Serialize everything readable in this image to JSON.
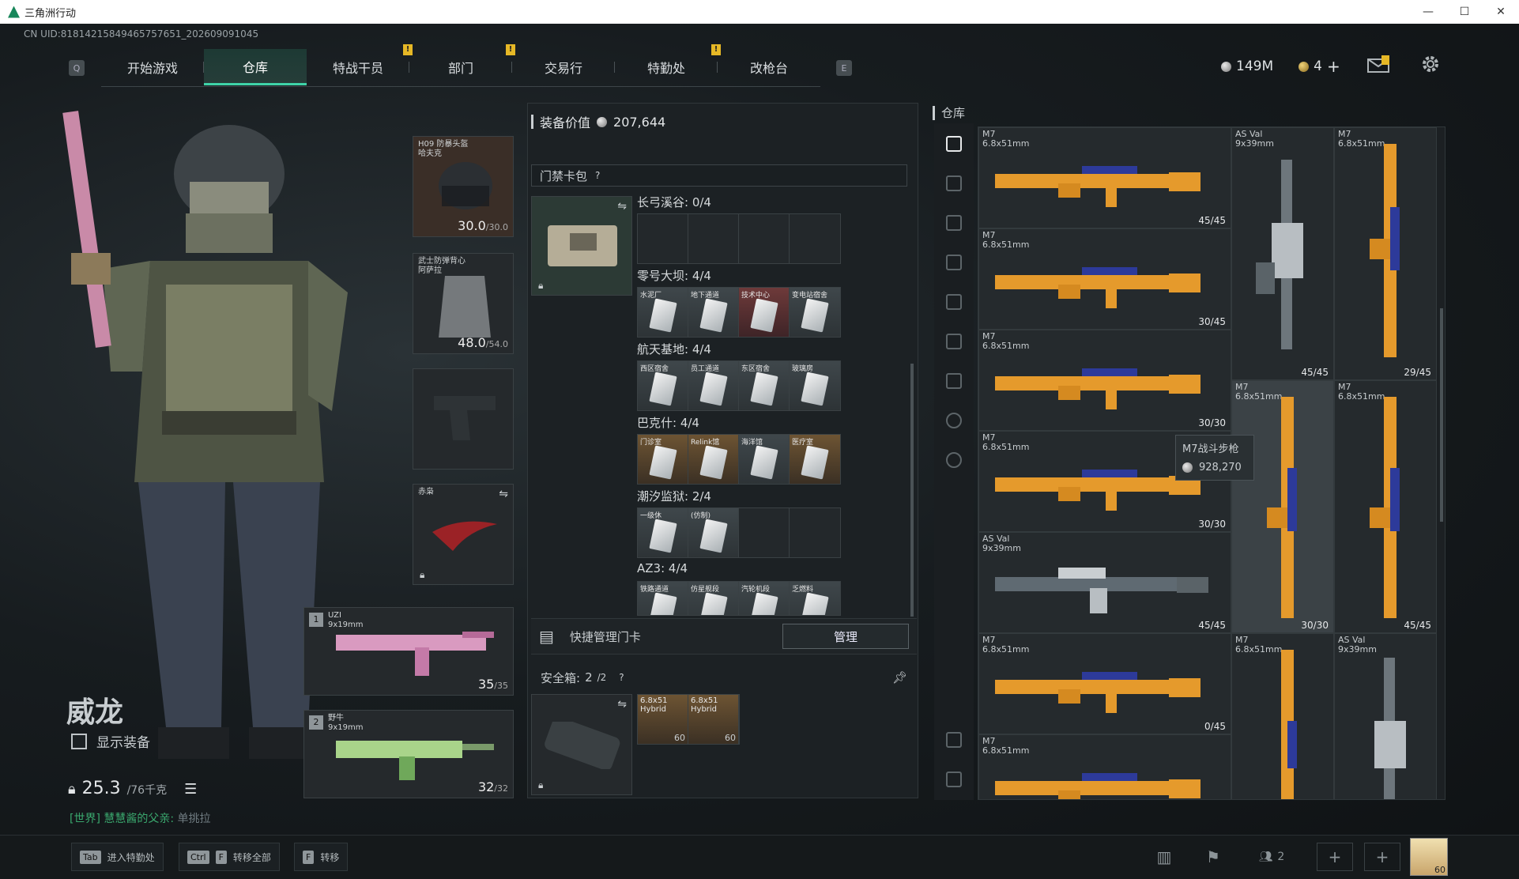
{
  "window": {
    "title": "三角洲行动",
    "min": "—",
    "max": "☐",
    "close": "✕"
  },
  "uid": "CN UID:81814215849465757651_202609091045",
  "nav": {
    "left_key": "Q",
    "right_key": "E",
    "tabs": [
      {
        "label": "开始游戏",
        "alert": false
      },
      {
        "label": "仓库",
        "alert": false,
        "active": true
      },
      {
        "label": "特战干员",
        "alert": true
      },
      {
        "label": "部门",
        "alert": true
      },
      {
        "label": "交易行",
        "alert": false
      },
      {
        "label": "特勤处",
        "alert": true
      },
      {
        "label": "改枪台",
        "alert": false
      }
    ],
    "alert_mark": "!"
  },
  "currency": {
    "coins": "149M",
    "tickets": "4",
    "plus": "+"
  },
  "operator": {
    "name": "威龙",
    "show_equipment": "显示装备",
    "weight": "25.3",
    "weight_max": "/76千克",
    "world_prefix": "[世界]",
    "world_text": " 慧慧酱的父亲:",
    "world_user": " 单挑拉"
  },
  "equipment": {
    "helmet": {
      "name": "H09 防暴头盔",
      "name2": "哈夫克",
      "durability": "30.0",
      "max": "/30.0"
    },
    "armor": {
      "name": "武士防弹背心",
      "name2": "阿萨拉",
      "durability": "48.0",
      "max": "/54.0"
    },
    "melee": {
      "name": "赤枭"
    },
    "primary": {
      "slot": "1",
      "name": "UZI",
      "caliber": "9x19mm",
      "ammo": "35",
      "max": "/35"
    },
    "secondary": {
      "slot": "2",
      "name": "野牛",
      "caliber": "9x19mm",
      "ammo": "32",
      "max": "/32"
    }
  },
  "middle": {
    "value_label": "装备价值",
    "value": "207,644",
    "keycard_pack": "门禁卡包",
    "help": "?",
    "sections": [
      {
        "title": "长弓溪谷: 0/4",
        "cards": []
      },
      {
        "title": "零号大坝: 4/4",
        "cards": [
          "水泥厂",
          "地下通道",
          "技术中心",
          "变电站宿舍"
        ]
      },
      {
        "title": "航天基地: 4/4",
        "cards": [
          "西区宿舍",
          "员工通道",
          "东区宿舍",
          "玻璃房"
        ]
      },
      {
        "title": "巴克什: 4/4",
        "cards": [
          "门诊室",
          "Relink馆",
          "海洋馆",
          "医疗室"
        ]
      },
      {
        "title": "潮汐监狱: 2/4",
        "cards": [
          "一级休",
          "(仿制)"
        ]
      },
      {
        "title": "AZ3: 4/4",
        "cards": [
          "铁路通道",
          "仿星舰段",
          "汽轮机段",
          "乏燃料"
        ]
      }
    ],
    "quick_manage": "快捷管理门卡",
    "manage_btn": "管理",
    "safebox_label": "安全箱:",
    "safebox_count": "2",
    "safebox_max": "/2",
    "safebox_items": [
      {
        "name": "6.8x51",
        "sub": "Hybrid",
        "qty": "60"
      },
      {
        "name": "6.8x51",
        "sub": "Hybrid",
        "qty": "60"
      }
    ]
  },
  "warehouse": {
    "title": "仓库",
    "items": [
      {
        "name": "M7",
        "caliber": "6.8x51mm",
        "ammo": "45/45"
      },
      {
        "name": "AS Val",
        "caliber": "9x39mm",
        "ammo": "45/45"
      },
      {
        "name": "M7",
        "caliber": "6.8x51mm",
        "ammo": "29/45"
      },
      {
        "name": "M7",
        "caliber": "6.8x51mm",
        "ammo": "30/45"
      },
      {
        "name": "M7",
        "caliber": "6.8x51mm",
        "ammo": "30/30"
      },
      {
        "name": "M7",
        "caliber": "6.8x51mm",
        "ammo": "30/30"
      },
      {
        "name": "M7",
        "caliber": "6.8x51mm",
        "ammo": "45/45"
      },
      {
        "name": "M7",
        "caliber": "6.8x51mm",
        "ammo": "30/30"
      },
      {
        "name": "AS Val",
        "caliber": "9x39mm",
        "ammo": "45/45"
      },
      {
        "name": "M7",
        "caliber": "6.8x51mm",
        "ammo": "0/45"
      },
      {
        "name": "M7",
        "caliber": "6.8x51mm",
        "ammo": ""
      },
      {
        "name": "AS Val",
        "caliber": "9x39mm",
        "ammo": ""
      },
      {
        "name": "M7",
        "caliber": "6.8x51mm",
        "ammo": ""
      }
    ],
    "tooltip": {
      "name": "M7战斗步枪",
      "price": "928,270"
    }
  },
  "bottom": {
    "hotkeys": [
      {
        "keys": [
          "Tab"
        ],
        "label": "进入特勤处"
      },
      {
        "keys": [
          "Ctrl",
          "F"
        ],
        "label": "转移全部"
      },
      {
        "keys": [
          "F"
        ],
        "label": "转移"
      }
    ],
    "friends": "2",
    "avatar_level": "60"
  },
  "colors": {
    "accent": "#3fd3a8",
    "alert": "#e6b826",
    "gun_orange": "#e59a2c",
    "world_chat": "#3aa86e"
  }
}
